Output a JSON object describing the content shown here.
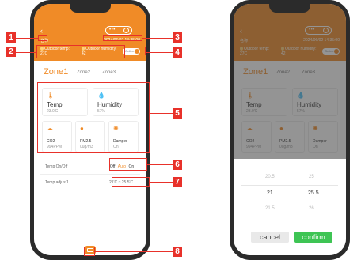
{
  "device": {
    "name": "名称",
    "timestamp": "2024/06/02 14:35:00",
    "outdoor_temp_label": "Outdoor temp:",
    "outdoor_temp_value": "27C",
    "outdoor_humidity_label": "Outdoor humidity:",
    "outdoor_humidity_value": "42",
    "online_label": "Online"
  },
  "zones": [
    {
      "label": "Zone1",
      "active": true
    },
    {
      "label": "Zone2",
      "active": false
    },
    {
      "label": "Zone3",
      "active": false
    }
  ],
  "cards": {
    "temp": {
      "title": "Temp",
      "value": "23.0'C",
      "icon": "thermometer-icon"
    },
    "humidity": {
      "title": "Humidity",
      "value": "57%",
      "icon": "droplet-icon"
    },
    "co2": {
      "title": "CO2",
      "value": "994PPM",
      "icon": "co2-icon"
    },
    "pm25": {
      "title": "PM2.5",
      "value": "0ug/m3",
      "icon": "pm-icon"
    },
    "damper": {
      "title": "Damper",
      "value": "On",
      "icon": "damper-icon"
    }
  },
  "controls": {
    "temp_onoff_label": "Temp On/Off",
    "mode_options": [
      "Off",
      "Auto",
      "On"
    ],
    "mode_selected": "Auto",
    "temp_adjust_label": "Temp adjust1",
    "temp_adjust_value": "21'C ~ 25.5'C"
  },
  "callouts": [
    "1",
    "2",
    "3",
    "4",
    "5",
    "6",
    "7",
    "8"
  ],
  "picker": {
    "left_column": [
      "20.5",
      "21",
      "21.5"
    ],
    "right_column": [
      "25",
      "25.5",
      "26"
    ],
    "cancel_label": "cancel",
    "confirm_label": "confirm"
  },
  "colors": {
    "accent": "#f08b27",
    "callout": "#e8312a",
    "confirm": "#3ec454"
  }
}
